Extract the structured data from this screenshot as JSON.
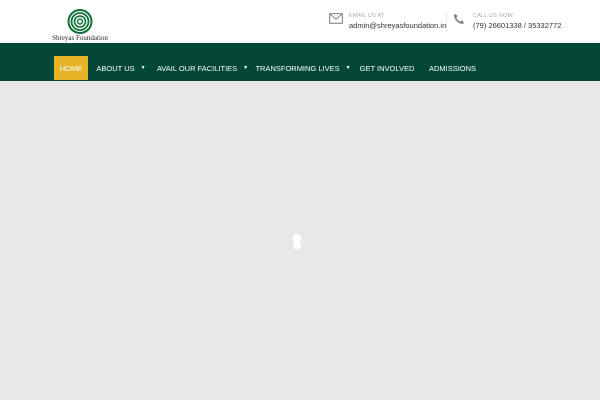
{
  "brand": {
    "name": "Shreyas Foundation",
    "accent": "#034837",
    "highlight": "#e6b426"
  },
  "contact": {
    "email_label": "EMAIL US AT",
    "email": "admin@shreyasfoundation.in",
    "phone_label": "CALL US NOW",
    "phone": "(79) 26601338 / 35332772"
  },
  "nav": {
    "items": [
      {
        "label": "HOME",
        "active": true
      },
      {
        "label": "ABOUT US",
        "dropdown": true
      },
      {
        "label": "AVAIL OUR FACILITIES",
        "dropdown": true
      },
      {
        "label": "TRANSFORMING LIVES",
        "dropdown": true
      },
      {
        "label": "GET INVOLVED"
      },
      {
        "label": "ADMISSIONS"
      }
    ],
    "caret": "▼"
  },
  "icons": {
    "email": "envelope-icon",
    "phone": "phone-icon",
    "loader": "loading-spinner-icon"
  }
}
